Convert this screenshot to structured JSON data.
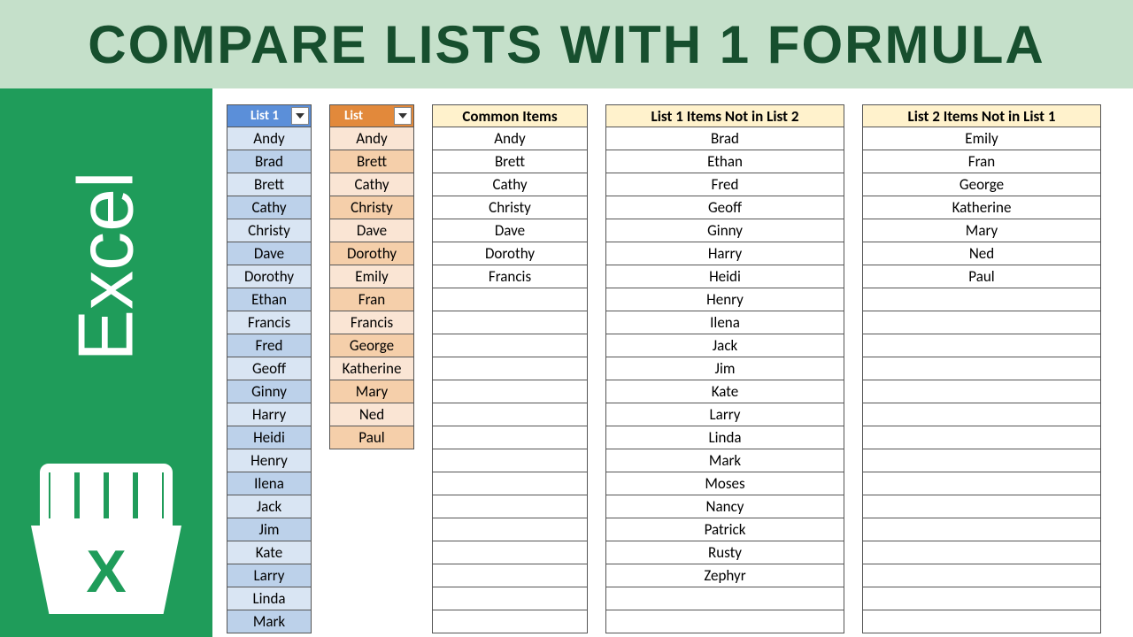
{
  "banner": "Compare Lists with 1 Formula",
  "badge": "Excel",
  "headers": {
    "list1": "List 1",
    "list2": "List",
    "common": "Common Items",
    "only1": "List 1 Items Not in List 2",
    "only2": "List 2 Items Not in List 1"
  },
  "list1": [
    "Andy",
    "Brad",
    "Brett",
    "Cathy",
    "Christy",
    "Dave",
    "Dorothy",
    "Ethan",
    "Francis",
    "Fred",
    "Geoff",
    "Ginny",
    "Harry",
    "Heidi",
    "Henry",
    "Ilena",
    "Jack",
    "Jim",
    "Kate",
    "Larry",
    "Linda",
    "Mark"
  ],
  "list2": [
    "Andy",
    "Brett",
    "Cathy",
    "Christy",
    "Dave",
    "Dorothy",
    "Emily",
    "Fran",
    "Francis",
    "George",
    "Katherine",
    "Mary",
    "Ned",
    "Paul"
  ],
  "common": [
    "Andy",
    "Brett",
    "Cathy",
    "Christy",
    "Dave",
    "Dorothy",
    "Francis",
    "",
    "",
    "",
    "",
    "",
    "",
    "",
    "",
    "",
    "",
    "",
    "",
    "",
    "",
    ""
  ],
  "only1": [
    "Brad",
    "Ethan",
    "Fred",
    "Geoff",
    "Ginny",
    "Harry",
    "Heidi",
    "Henry",
    "Ilena",
    "Jack",
    "Jim",
    "Kate",
    "Larry",
    "Linda",
    "Mark",
    "Moses",
    "Nancy",
    "Patrick",
    "Rusty",
    "Zephyr",
    "",
    ""
  ],
  "only2": [
    "Emily",
    "Fran",
    "George",
    "Katherine",
    "Mary",
    "Ned",
    "Paul",
    "",
    "",
    "",
    "",
    "",
    "",
    "",
    "",
    "",
    "",
    "",
    "",
    "",
    "",
    ""
  ]
}
